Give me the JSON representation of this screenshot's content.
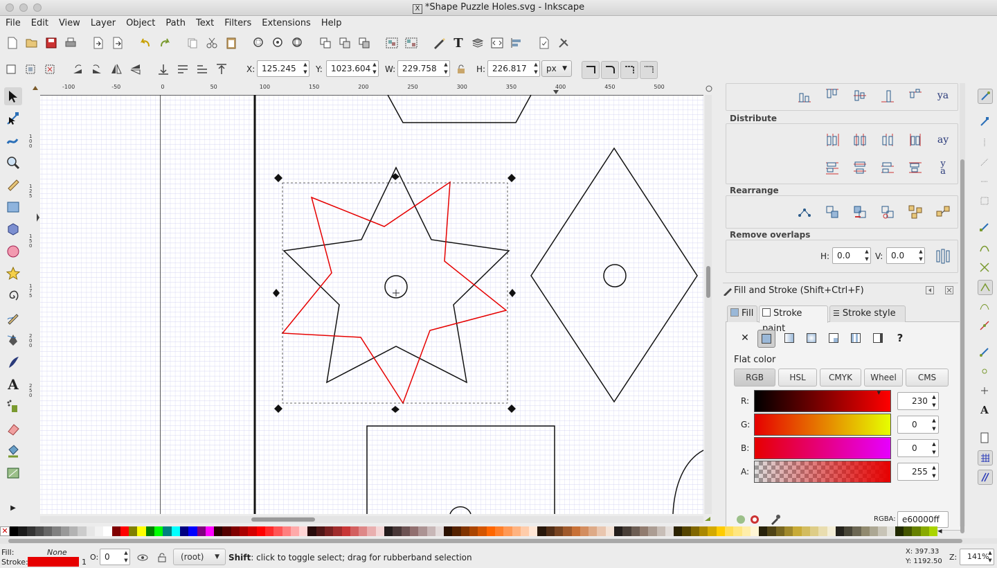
{
  "window": {
    "title": "*Shape Puzzle Holes.svg - Inkscape",
    "x11_badge": "X"
  },
  "menu": [
    "File",
    "Edit",
    "View",
    "Layer",
    "Object",
    "Path",
    "Text",
    "Filters",
    "Extensions",
    "Help"
  ],
  "toolbar_controls": {
    "x_label": "X:",
    "x_value": "125.245",
    "y_label": "Y:",
    "y_value": "1023.604",
    "w_label": "W:",
    "w_value": "229.758",
    "h_label": "H:",
    "h_value": "226.817",
    "unit": "px"
  },
  "ruler": {
    "h_ticks": [
      "-100",
      "-50",
      "0",
      "50",
      "100",
      "150",
      "200",
      "250",
      "300",
      "350",
      "400",
      "450",
      "500"
    ],
    "v_ticks": [
      "1\n0\n0",
      "1\n2\n5",
      "1\n5\n0",
      "1\n7\n5",
      "2\n0\n0",
      "2\n5\n0"
    ]
  },
  "align_panel": {
    "distribute_title": "Distribute",
    "rearrange_title": "Rearrange",
    "remove_overlaps_title": "Remove overlaps",
    "h_label": "H:",
    "h_value": "0.0",
    "v_label": "V:",
    "v_value": "0.0"
  },
  "fill_stroke": {
    "panel_title": "Fill and Stroke (Shift+Ctrl+F)",
    "tabs": [
      "Fill",
      "Stroke paint",
      "Stroke style"
    ],
    "active_tab": "Stroke paint",
    "paint_type": "Flat color",
    "modes": [
      "RGB",
      "HSL",
      "CMYK",
      "Wheel",
      "CMS"
    ],
    "active_mode": "RGB",
    "channels": [
      {
        "label": "R:",
        "value": "230"
      },
      {
        "label": "G:",
        "value": "0"
      },
      {
        "label": "B:",
        "value": "0"
      },
      {
        "label": "A:",
        "value": "255"
      }
    ],
    "rgba_label": "RGBA:",
    "rgba_value": "e60000ff",
    "stroke_color": "#e60000"
  },
  "status": {
    "fill_label": "Fill:",
    "fill_value": "None",
    "stroke_label": "Stroke:",
    "stroke_width": "1",
    "opacity_label": "O:",
    "opacity_value": "0",
    "layer": "(root)",
    "message_bold": "Shift",
    "message": ": click to toggle select; drag for rubberband selection",
    "x_readout": "X:  397.33",
    "y_readout": "Y: 1192.50",
    "zoom_label": "Z:",
    "zoom_value": "141%"
  },
  "palette": [
    "#000000",
    "#1a1a1a",
    "#333333",
    "#4d4d4d",
    "#666666",
    "#808080",
    "#999999",
    "#b3b3b3",
    "#cccccc",
    "#e6e6e6",
    "#f2f2f2",
    "#ffffff",
    "#800000",
    "#ff0000",
    "#808000",
    "#ffff00",
    "#008000",
    "#00ff00",
    "#008080",
    "#00ffff",
    "#000080",
    "#0000ff",
    "#800080",
    "#ff00ff",
    "#2b0000",
    "#550000",
    "#800000",
    "#aa0000",
    "#d40000",
    "#ff0000",
    "#ff2a2a",
    "#ff5555",
    "#ff8080",
    "#ffaaaa",
    "#ffd5d5",
    "#280b0b",
    "#501616",
    "#782121",
    "#a02c2c",
    "#c83737",
    "#d35f5f",
    "#de8787",
    "#e9afaf",
    "#f4d7d7",
    "#241c1c",
    "#483737",
    "#6c5353",
    "#916f6f",
    "#ac9393",
    "#c8b7b7",
    "#e3dbdb",
    "#2b1100",
    "#552200",
    "#803300",
    "#aa4400",
    "#d45500",
    "#ff6600",
    "#ff7f2a",
    "#ff9955",
    "#ffb380",
    "#ffccaa",
    "#ffe6d5",
    "#28170b",
    "#502d16",
    "#784421",
    "#a05a2c",
    "#c87137",
    "#d38d5f",
    "#deaa87",
    "#e9c6af",
    "#f4e3d7",
    "#241f1c",
    "#483e37",
    "#6c5d53",
    "#917c6f",
    "#ac9d93",
    "#c8beb7",
    "#e3dedb",
    "#2b2200",
    "#554400",
    "#806600",
    "#aa8800",
    "#d4aa00",
    "#ffcc00",
    "#ffdd55",
    "#ffe680",
    "#ffeeaa",
    "#fff6d5",
    "#28220b",
    "#504416",
    "#786721",
    "#a0892c",
    "#c8ab37",
    "#d3bc5f",
    "#decd87",
    "#e9ddaf",
    "#f4eed7",
    "#24221c",
    "#484537",
    "#6c6753",
    "#918a6f",
    "#aca793",
    "#c8c4b7",
    "#e3e2db",
    "#222b00",
    "#445500",
    "#668000",
    "#88aa00",
    "#aad400"
  ]
}
